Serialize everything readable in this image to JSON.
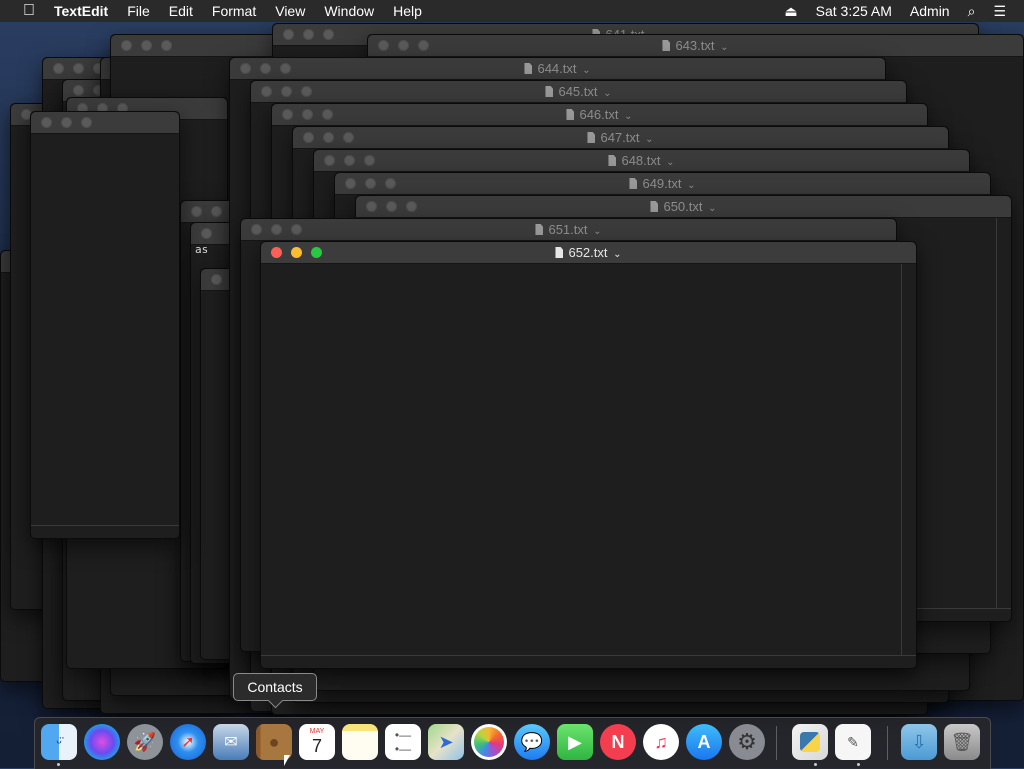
{
  "menubar": {
    "app_name": "TextEdit",
    "menus": [
      "File",
      "Edit",
      "Format",
      "View",
      "Window",
      "Help"
    ],
    "clock": "Sat 3:25 AM",
    "user": "Admin",
    "eject_glyph": "⏏",
    "search_glyph": "⌕",
    "list_glyph": "☰"
  },
  "windows": {
    "w641": "641.txt",
    "w643": "643.txt",
    "w644": "644.txt",
    "w645": "645.txt",
    "w646": "646.txt",
    "w647": "647.txt",
    "w648": "648.txt",
    "w649": "649.txt",
    "w650": "650.txt",
    "w651": "651.txt",
    "w652": "652.txt"
  },
  "chevron": "⌄",
  "edge_text": "as",
  "tooltip": "Contacts",
  "dock": {
    "calendar_month": "MAY",
    "calendar_day": "7"
  },
  "icons": {
    "apple": "apple-logo-icon",
    "finder": "finder-icon",
    "siri": "siri-icon",
    "launchpad": "launchpad-icon",
    "safari": "safari-icon",
    "mail": "mail-icon",
    "contacts": "contacts-icon",
    "calendar": "calendar-icon",
    "notes": "notes-icon",
    "reminders": "reminders-icon",
    "maps": "maps-icon",
    "photos": "photos-icon",
    "messages": "messages-icon",
    "facetime": "facetime-icon",
    "news": "news-icon",
    "music": "music-icon",
    "appstore": "app-store-icon",
    "preferences": "system-preferences-icon",
    "python": "python-launcher-icon",
    "textedit": "textedit-icon",
    "downloads": "downloads-folder-icon",
    "trash": "trash-icon"
  },
  "colors": {
    "close": "#ff5f57",
    "minimize": "#febc2e",
    "zoom": "#28c840"
  }
}
